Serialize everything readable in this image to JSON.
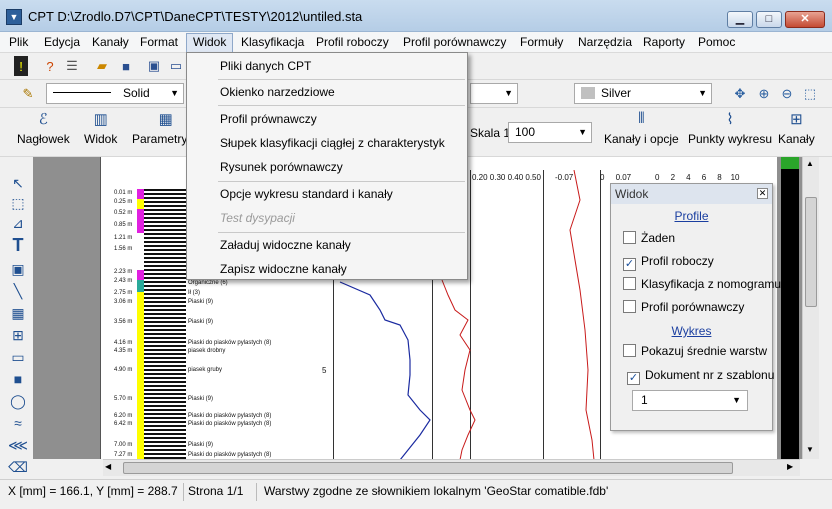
{
  "window": {
    "title": "CPT D:\\Zrodlo.D7\\CPT\\DaneCPT\\TESTY\\2012\\untiled.sta",
    "minimize": "▁",
    "maximize": "□",
    "close": "✕"
  },
  "menu": [
    "Plik",
    "Edycja",
    "Kanały",
    "Format",
    "Widok",
    "Klasyfikacja",
    "Profil roboczy",
    "Profil porównawczy",
    "Formuły",
    "Narzędzia",
    "Raporty",
    "Pomoc"
  ],
  "toolbar": {
    "line_style": "Solid",
    "color_combo": "Silver",
    "scale_label": "Skala 1:",
    "scale_value": "100"
  },
  "big_buttons": [
    "Nagłowek",
    "Widok",
    "Parametry w",
    "Kanały i opcje",
    "Punkty wykresu",
    "Kanały"
  ],
  "dropdown": [
    "Pliki danych CPT",
    "Okienko narzedziowe",
    "Profil prównawczy",
    "Słupek klasyfikacji ciągłej z charakterystyk",
    "Rysunek porównawczy",
    "Opcje wykresu standard i kanały",
    "Test dysypacji",
    "Załaduj widoczne kanały",
    "Zapisz widoczne kanały"
  ],
  "panel": {
    "title": "Widok",
    "section_profile": "Profile",
    "items": [
      {
        "label": "Żaden",
        "checked": false
      },
      {
        "label": "Profil roboczy",
        "checked": true
      },
      {
        "label": "Klasyfikacja z nomogramu",
        "checked": false
      },
      {
        "label": "Profil porównawczy",
        "checked": false
      }
    ],
    "section_chart": "Wykres",
    "chart_items": [
      {
        "label": "Pokazuj średnie warstw",
        "checked": false
      },
      {
        "label": "Dokument nr z szablonu",
        "checked": true
      }
    ],
    "combo_value": "1"
  },
  "plot": {
    "axis1": "0.20  0.30  0.40  0.50",
    "axis2": "-0.07",
    "axis3": "0     0.07",
    "axis4": "0     2     4     6     8    10",
    "depths": [
      "0.01 m",
      "0.25 m",
      "0.52 m",
      "0.85 m",
      "1.21 m",
      "1.56 m",
      "2.23 m",
      "2.43 m",
      "2.75 m",
      "3.06 m",
      "3.56 m",
      "4.16 m",
      "4.35 m",
      "4.90 m",
      "5.70 m",
      "6.20 m",
      "6.42 m",
      "7.00 m",
      "7.27 m"
    ],
    "soils": [
      "Organiczne (6)",
      "Ił (3)",
      "Piaski (9)",
      "Piaski (9)",
      "Piaski do piasków pylastych (8)",
      "piasek drobny",
      "piasek gruby",
      "Piaski (9)",
      "Piaski do piasków pylastych (8)",
      "Piaski do piasków pylastych (8)",
      "Piaski (9)",
      "Piaski do piasków pylastych (8)"
    ],
    "depth_marker": "5"
  },
  "status": {
    "coords": "X [mm] = 166.1, Y [mm] =  288.7",
    "page": "Strona 1/1",
    "message": "Warstwy zgodne ze słownikiem lokalnym 'GeoStar comatible.fdb'"
  }
}
